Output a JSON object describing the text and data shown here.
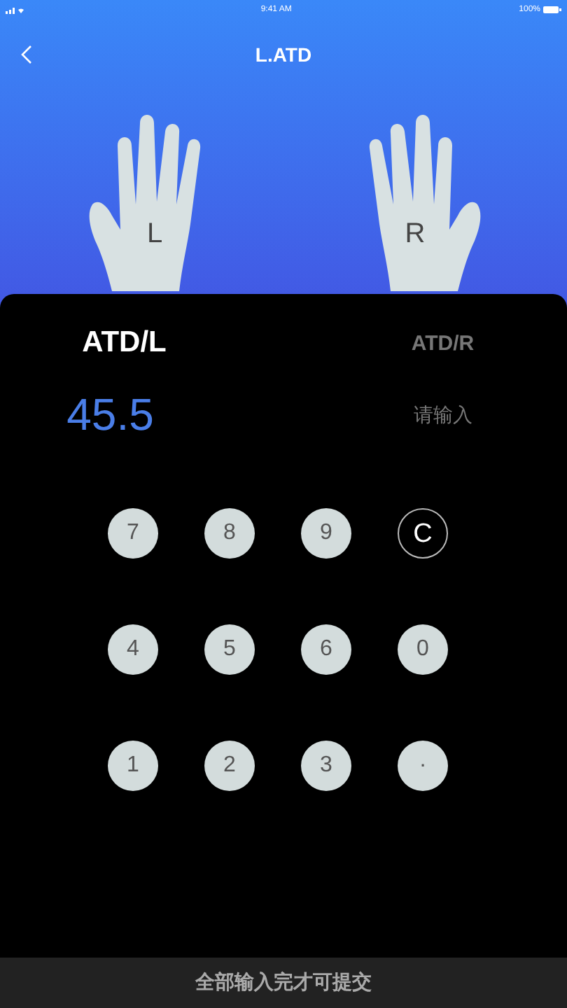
{
  "status_bar": {
    "time": "9:41 AM",
    "battery": "100%"
  },
  "header": {
    "title": "L.ATD"
  },
  "hands": [
    {
      "label": "L",
      "kind": "left"
    },
    {
      "label": "R",
      "kind": "right"
    }
  ],
  "tabs": [
    {
      "label": "ATD/L",
      "selected": true,
      "value": "45.5"
    },
    {
      "label": "ATD/R",
      "selected": false,
      "placeholder": "请输入"
    }
  ],
  "keypad": [
    {
      "kind": "digit",
      "label": "7"
    },
    {
      "kind": "digit",
      "label": "8"
    },
    {
      "kind": "digit",
      "label": "9"
    },
    {
      "kind": "clear",
      "label": "C"
    },
    {
      "kind": "digit",
      "label": "4"
    },
    {
      "kind": "digit",
      "label": "5"
    },
    {
      "kind": "digit",
      "label": "6"
    },
    {
      "kind": "digit",
      "label": "0"
    },
    {
      "kind": "digit",
      "label": "1"
    },
    {
      "kind": "digit",
      "label": "2"
    },
    {
      "kind": "digit",
      "label": "3"
    },
    {
      "kind": "digit",
      "label": "·"
    }
  ],
  "submit": {
    "label": "全部输入完才可提交",
    "disabled": true
  }
}
